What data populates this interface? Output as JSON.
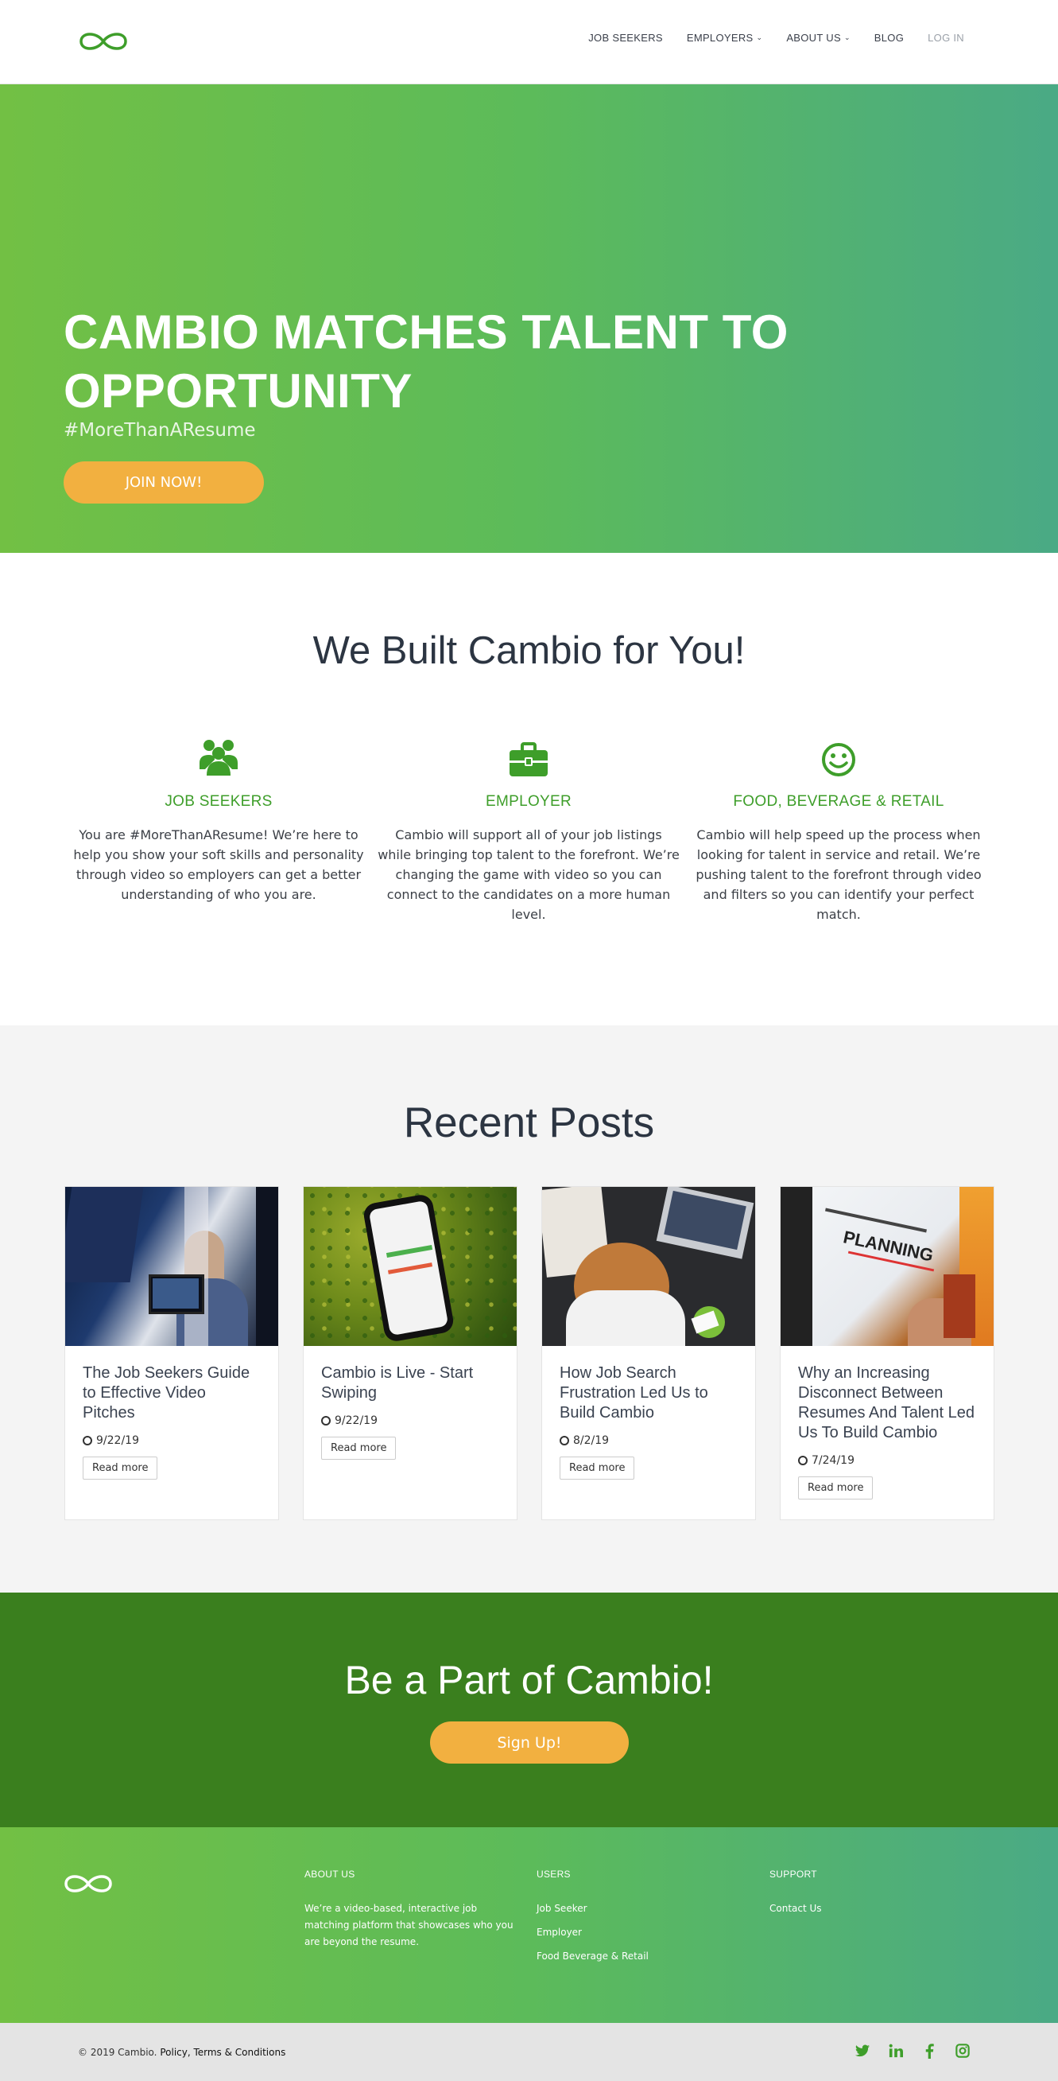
{
  "nav": {
    "items": [
      {
        "label": "JOB SEEKERS",
        "caret": false
      },
      {
        "label": "EMPLOYERS",
        "caret": true
      },
      {
        "label": "ABOUT US",
        "caret": true
      },
      {
        "label": "BLOG",
        "caret": false
      },
      {
        "label": "LOG IN",
        "caret": false
      }
    ]
  },
  "hero": {
    "title": "CAMBIO MATCHES TALENT TO OPPORTUNITY",
    "tagline": "#MoreThanAResume",
    "cta": "JOIN NOW!"
  },
  "built": {
    "title": "We Built Cambio for You!",
    "features": [
      {
        "icon": "users-icon",
        "title": "JOB SEEKERS",
        "text": "You are #MoreThanAResume! We’re here to help you show your soft skills and personality through video so employers can get a better understanding of who you are."
      },
      {
        "icon": "briefcase-icon",
        "title": "EMPLOYER",
        "text": "Cambio will support all of your job listings while bringing top talent to the forefront. We’re changing the game with video so you can connect to the candidates on a more human level."
      },
      {
        "icon": "smile-icon",
        "title": "FOOD, BEVERAGE & RETAIL",
        "text": "Cambio will help speed up the process when looking for talent in service and retail. We’re pushing talent to the forefront through video and filters so you can identify your perfect match."
      }
    ]
  },
  "posts": {
    "title": "Recent Posts",
    "items": [
      {
        "title": "The Job Seekers Guide to Effective Video Pitches",
        "date": "9/22/19",
        "read_label": "Read more"
      },
      {
        "title": "Cambio is Live - Start Swiping",
        "date": "9/22/19",
        "read_label": "Read more"
      },
      {
        "title": "How Job Search Frustration Led Us to Build Cambio",
        "date": "8/2/19",
        "read_label": "Read more"
      },
      {
        "title": "Why an Increasing Disconnect Between Resumes And Talent Led Us To Build Cambio",
        "date": "7/24/19",
        "read_label": "Read more"
      }
    ]
  },
  "cta": {
    "title": "Be a Part of Cambio!",
    "button": "Sign Up!"
  },
  "footer": {
    "about_heading": "ABOUT US",
    "about_text": "We’re a video-based, interactive job matching platform that showcases who you are beyond the resume.",
    "users_heading": "USERS",
    "users_links": [
      "Job Seeker",
      "Employer",
      "Food Beverage & Retail"
    ],
    "support_heading": "SUPPORT",
    "support_links": [
      "Contact Us"
    ]
  },
  "bottom": {
    "copyright": "© 2019 Cambio.",
    "policy": "Policy, Terms & Conditions",
    "social": [
      "twitter-icon",
      "linkedin-icon",
      "facebook-icon",
      "instagram-icon"
    ]
  },
  "colors": {
    "brand_green": "#3e9e2a",
    "dark_green": "#3a7f1e",
    "accent_orange": "#f2b040"
  }
}
